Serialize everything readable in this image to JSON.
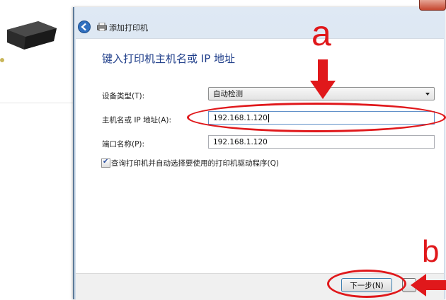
{
  "window": {
    "title": "添加打印机",
    "icons": {
      "back": "back-arrow-icon",
      "printer": "printer-icon",
      "close": "close-icon"
    }
  },
  "heading": "键入打印机主机名或 IP 地址",
  "form": {
    "device_type_label": "设备类型(T):",
    "device_type_value": "自动检测",
    "hostname_label": "主机名或 IP 地址(A):",
    "hostname_value": "192.168.1.120",
    "port_label": "端口名称(P):",
    "port_value": "192.168.1.120",
    "query_checkbox_label": "查询打印机并自动选择要使用的打印机驱动程序(Q)",
    "query_checked": true
  },
  "footer": {
    "next_label": "下一步(N)"
  },
  "annotations": {
    "a": "a",
    "b": "b",
    "color": "#e0181b"
  }
}
